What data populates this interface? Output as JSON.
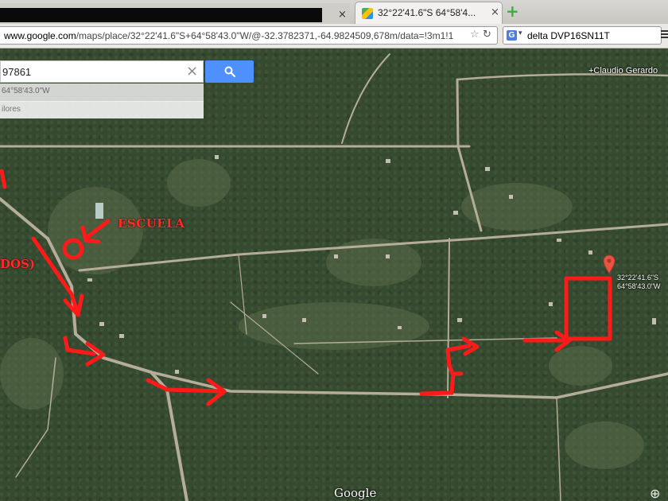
{
  "browser": {
    "tabs": [
      {
        "label": "",
        "redacted": true
      },
      {
        "label": "32°22'41.6\"S 64°58'4...",
        "active": true
      }
    ],
    "new_tab_icon": "plus-icon",
    "url": {
      "host": "www.google.com",
      "prefix": "",
      "path": "/maps/place/32°22'41.6\"S+64°58'43.0\"W/@-32.3782371,-64.9824509,678m/data=!3m1!1"
    },
    "search": {
      "engine_icon": "G",
      "value": "delta DVP16SN11T"
    }
  },
  "maps_panel": {
    "search_value": "97861",
    "search_button_icon": "search-icon",
    "result_line": "64°58'43.0\"W",
    "result_sub": "ilores"
  },
  "map": {
    "place_label": "+Claudio Gerardo",
    "annotation_school": "ESCUELA",
    "annotation_partial": "DOS)",
    "pin_coord_lat": "32°22'41.6\"S",
    "pin_coord_lng": "64°58'43.0\"W",
    "watermark": "Google",
    "accent_color": "#ff1a1a",
    "pin_color": "#e8553e"
  }
}
